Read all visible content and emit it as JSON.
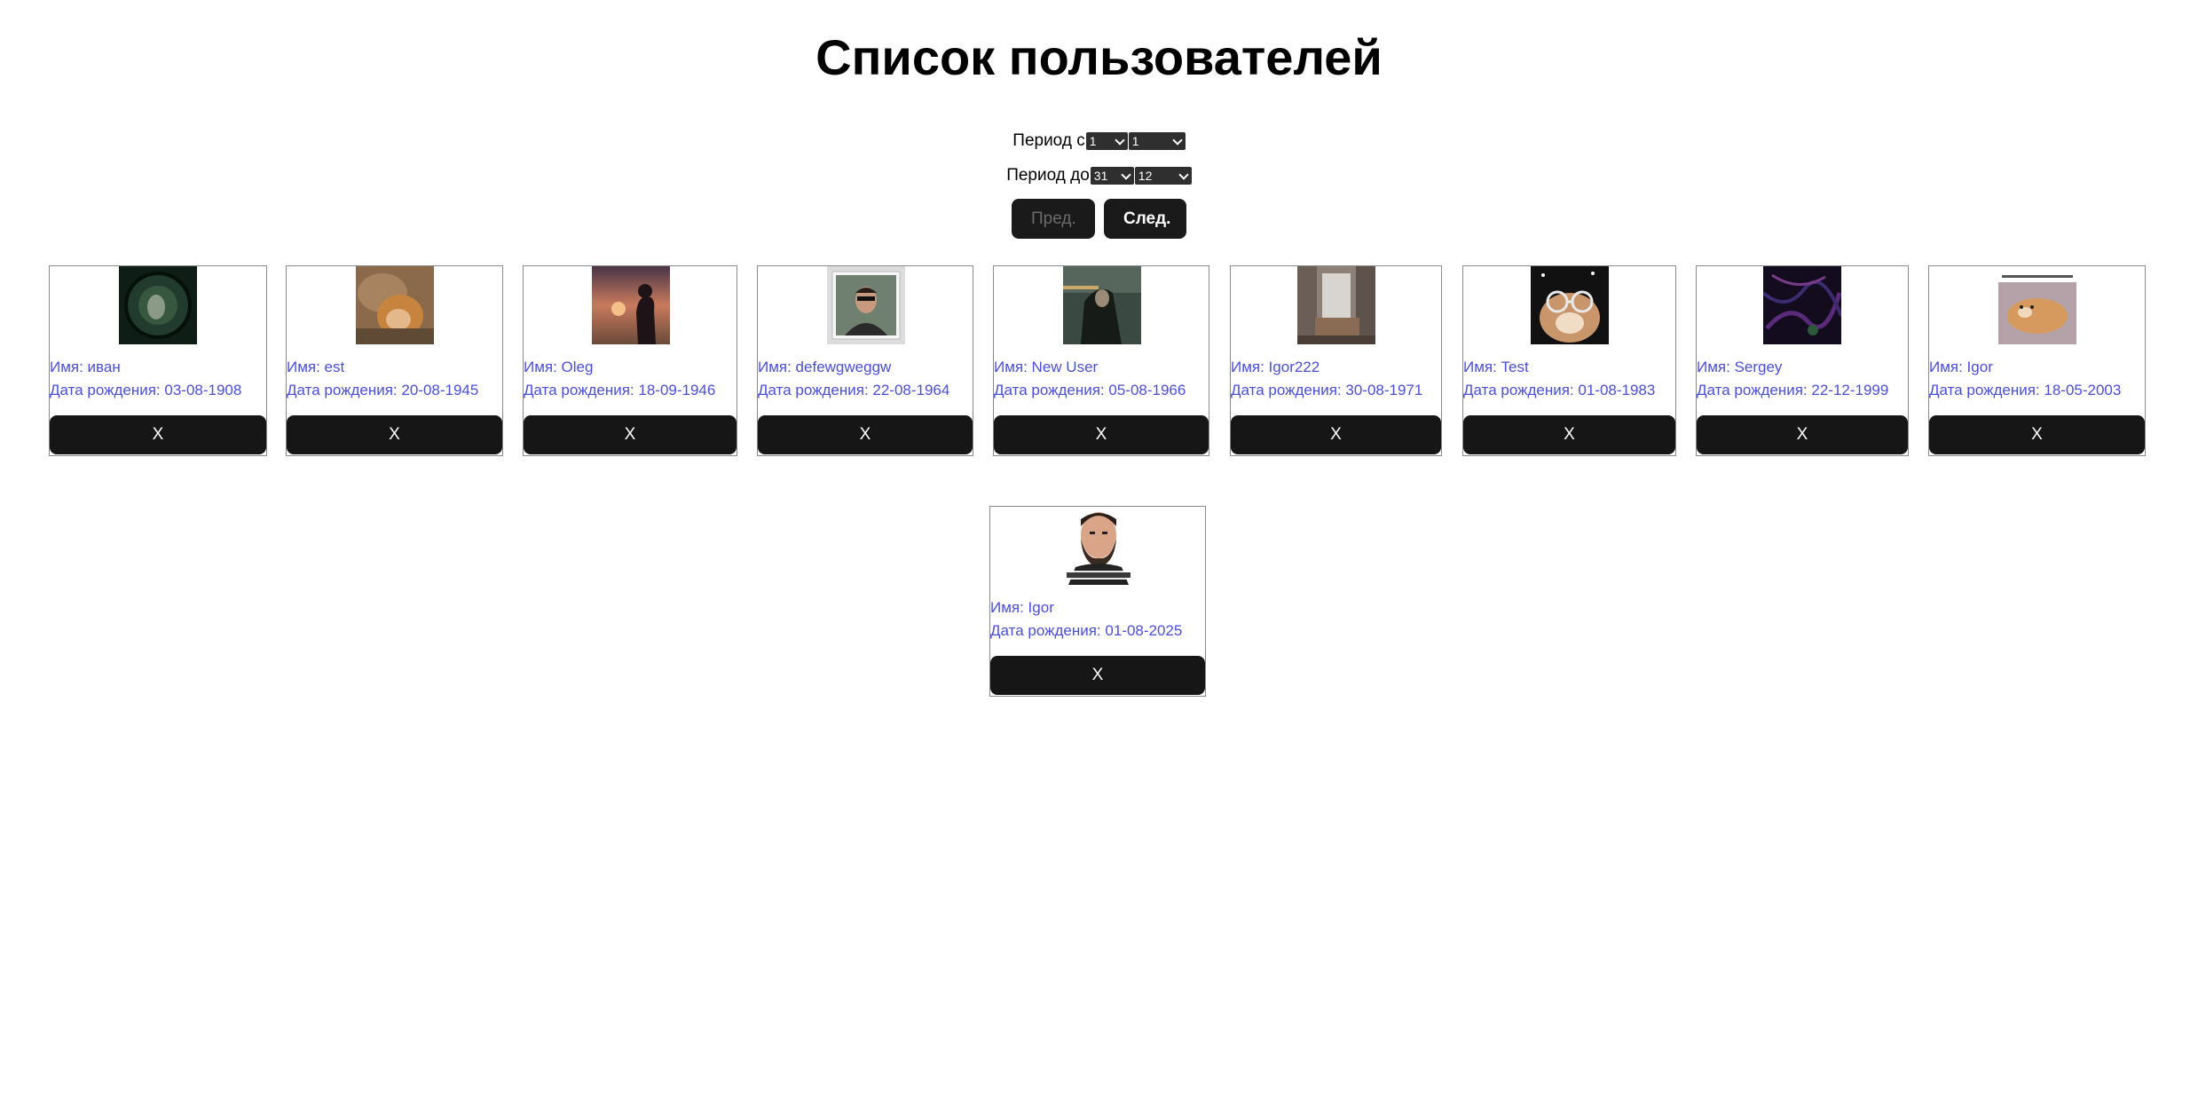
{
  "page": {
    "title": "Список пользователей"
  },
  "filters": {
    "from_label": "Период с",
    "from_day": "1",
    "from_month": "1",
    "to_label": "Период до",
    "to_day": "31",
    "to_month": "12"
  },
  "pager": {
    "prev_label": "Пред.",
    "next_label": "След."
  },
  "users": [
    {
      "name_label": "Имя: иван",
      "dob_label": "Дата рождения: 03-08-1908",
      "delete_label": "X"
    },
    {
      "name_label": "Имя: est",
      "dob_label": "Дата рождения: 20-08-1945",
      "delete_label": "X"
    },
    {
      "name_label": "Имя: Oleg",
      "dob_label": "Дата рождения: 18-09-1946",
      "delete_label": "X"
    },
    {
      "name_label": "Имя: defewgweggw",
      "dob_label": "Дата рождения: 22-08-1964",
      "delete_label": "X"
    },
    {
      "name_label": "Имя: New User",
      "dob_label": "Дата рождения: 05-08-1966",
      "delete_label": "X"
    },
    {
      "name_label": "Имя: Igor222",
      "dob_label": "Дата рождения: 30-08-1971",
      "delete_label": "X"
    },
    {
      "name_label": "Имя: Test",
      "dob_label": "Дата рождения: 01-08-1983",
      "delete_label": "X"
    },
    {
      "name_label": "Имя: Sergey",
      "dob_label": "Дата рождения: 22-12-1999",
      "delete_label": "X"
    },
    {
      "name_label": "Имя: Igor",
      "dob_label": "Дата рождения: 18-05-2003",
      "delete_label": "X"
    },
    {
      "name_label": "Имя: Igor",
      "dob_label": "Дата рождения: 01-08-2025",
      "delete_label": "X"
    }
  ]
}
